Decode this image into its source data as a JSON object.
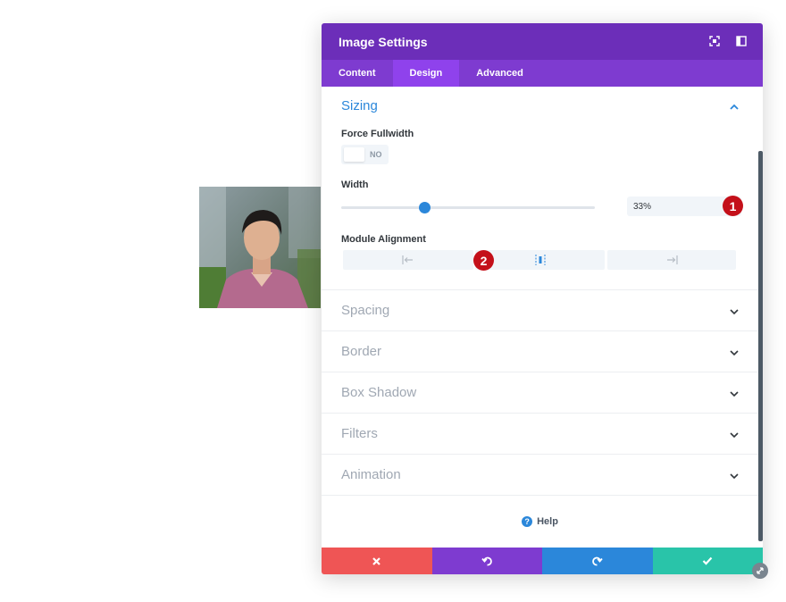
{
  "modal": {
    "title": "Image Settings",
    "tabs": [
      {
        "label": "Content",
        "active": false
      },
      {
        "label": "Design",
        "active": true
      },
      {
        "label": "Advanced",
        "active": false
      }
    ],
    "header_icons": [
      "fullscreen-icon",
      "split-view-icon"
    ]
  },
  "sizing": {
    "title": "Sizing",
    "expanded": true,
    "force_fullwidth": {
      "label": "Force Fullwidth",
      "value": "NO"
    },
    "width": {
      "label": "Width",
      "value": "33%",
      "slider_percent": 33
    },
    "module_alignment": {
      "label": "Module Alignment",
      "options": [
        "align-left-icon",
        "align-center-icon",
        "align-right-icon"
      ],
      "selected": "center"
    }
  },
  "sections": [
    {
      "title": "Spacing"
    },
    {
      "title": "Border"
    },
    {
      "title": "Box Shadow"
    },
    {
      "title": "Filters"
    },
    {
      "title": "Animation"
    }
  ],
  "annotations": {
    "badge_1": "1",
    "badge_2": "2"
  },
  "help": {
    "label": "Help"
  },
  "footer": {
    "buttons": [
      {
        "icon": "close-icon",
        "color": "#ef5555"
      },
      {
        "icon": "undo-icon",
        "color": "#7e3bd0"
      },
      {
        "icon": "redo-icon",
        "color": "#2b87da"
      },
      {
        "icon": "check-icon",
        "color": "#29c4a9"
      }
    ]
  },
  "colors": {
    "header": "#6c2eb9",
    "tabs": "#7e3bd0",
    "accent": "#2b87da",
    "badge": "#c4101a"
  }
}
